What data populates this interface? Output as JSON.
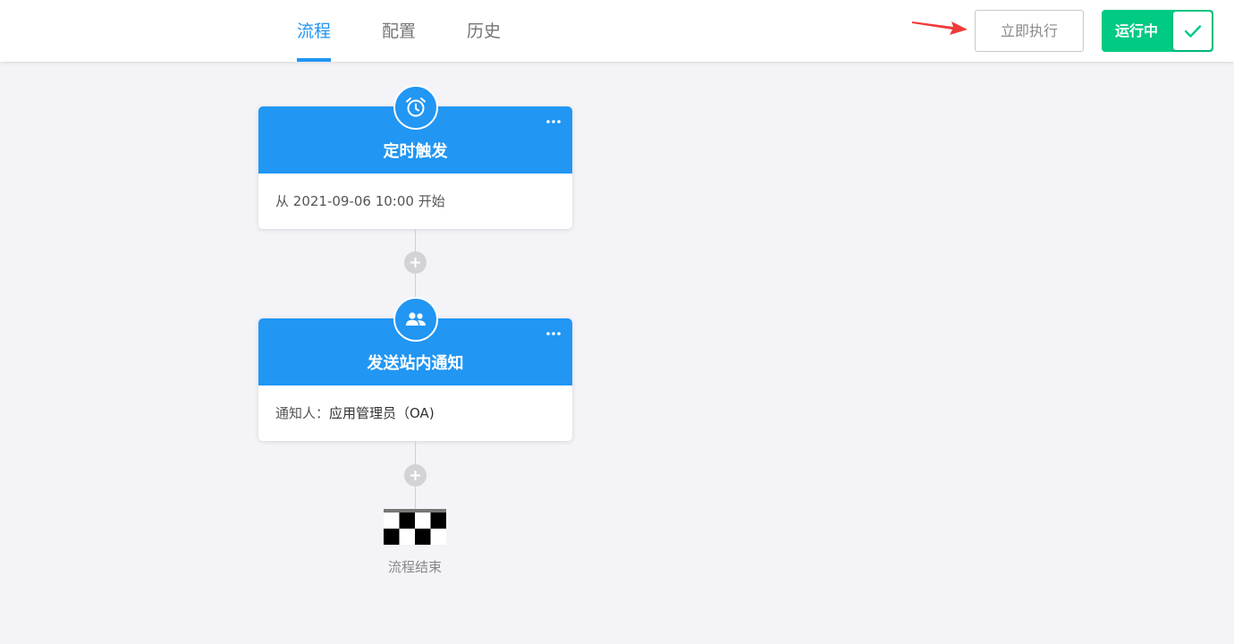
{
  "tabs": [
    {
      "label": "流程",
      "active": true
    },
    {
      "label": "配置",
      "active": false
    },
    {
      "label": "历史",
      "active": false
    }
  ],
  "toolbar": {
    "run_now_label": "立即执行",
    "status_label": "运行中",
    "status_on": true
  },
  "colors": {
    "primary": "#2196f3",
    "status_green": "#01ca83",
    "arrow_red": "#f03a3a"
  },
  "nodes": [
    {
      "icon": "alarm-clock-icon",
      "title": "定时触发",
      "prefix": "从 ",
      "value": "2021-09-06 10:00",
      "suffix": " 开始"
    },
    {
      "icon": "group-icon",
      "title": "发送站内通知",
      "prefix": "通知人：",
      "value": "应用管理员（OA)",
      "suffix": ""
    }
  ],
  "end": {
    "icon": "checkered-flag-icon",
    "label": "流程结束"
  }
}
